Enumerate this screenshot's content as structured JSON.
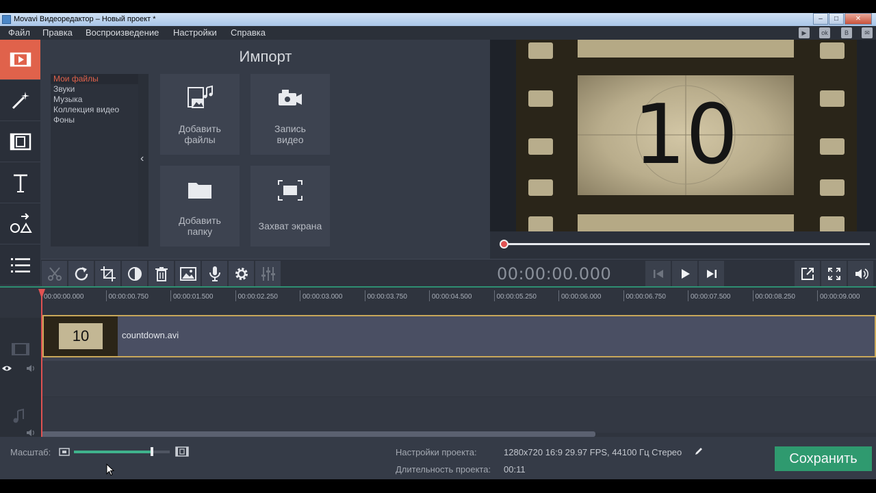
{
  "window": {
    "title": "Movavi Видеоредактор – Новый проект *"
  },
  "menu": [
    "Файл",
    "Правка",
    "Воспроизведение",
    "Настройки",
    "Справка"
  ],
  "social_icons": [
    "youtube-icon",
    "odnoklassniki-icon",
    "vk-icon",
    "feedback-icon"
  ],
  "import": {
    "title": "Импорт",
    "categories": [
      "Мои файлы",
      "Звуки",
      "Музыка",
      "Коллекция видео",
      "Фоны"
    ],
    "selected_category": "Мои файлы",
    "tiles": {
      "add_files": "Добавить\nфайлы",
      "record_video": "Запись\nвидео",
      "add_folder": "Добавить\nпапку",
      "screen_capture": "Захват экрана"
    }
  },
  "preview": {
    "frame_number": "10",
    "timecode": "00:00:00.000",
    "progress": 0
  },
  "timeline": {
    "ticks": [
      "00:00:00.000",
      "00:00:00.750",
      "00:00:01.500",
      "00:00:02.250",
      "00:00:03.000",
      "00:00:03.750",
      "00:00:04.500",
      "00:00:05.250",
      "00:00:06.000",
      "00:00:06.750",
      "00:00:07.500",
      "00:00:08.250",
      "00:00:09.000"
    ],
    "clip": {
      "name": "countdown.avi",
      "thumb_number": "10"
    }
  },
  "bottom": {
    "zoom_label": "Масштаб:",
    "zoom_value": 0.82,
    "project_settings_label": "Настройки проекта:",
    "project_settings_value": "1280x720 16:9 29.97 FPS, 44100 Гц Стерео",
    "duration_label": "Длительность проекта:",
    "duration_value": "00:11",
    "save_label": "Сохранить"
  },
  "colors": {
    "accent": "#e0624b",
    "save": "#2f9a6f",
    "timeline_border": "#2e8f72",
    "playhead": "#e05252"
  }
}
